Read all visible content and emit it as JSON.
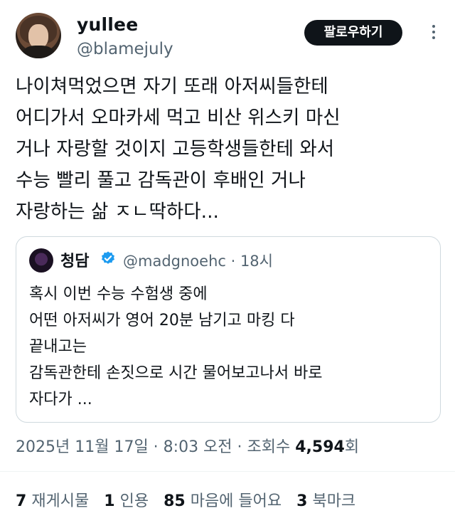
{
  "author": {
    "name": "yullee",
    "handle": "@blamejuly"
  },
  "follow_button": "팔로우하기",
  "tweet_text": "나이쳐먹었으면 자기 또래 아저씨들한테\n어디가서 오마카세 먹고 비산 위스키 마신\n거나 자랑할 것이지 고등학생들한테 와서\n수능 빨리 풀고 감독관이 후배인 거나\n자랑하는 삶 ㅈㄴ딱하다...",
  "quoted_tweet": {
    "name": "청담",
    "handle_time": "@madgnoehc · 18시",
    "text": "혹시 이번 수능 수험생 중에\n어떤 아저씨가 영어 20분 남기고 마킹 다\n끝내고는\n감독관한테 손짓으로 시간 물어보고나서 바로\n자다가 ..."
  },
  "timestamp": {
    "datetime": "2025년 11월 17일 · 8:03 오전 · 조회수 ",
    "views": "4,594",
    "views_suffix": "회"
  },
  "stats": {
    "retweets": "7",
    "retweets_label": "재게시물",
    "quotes": "1",
    "quotes_label": "인용",
    "likes": "85",
    "likes_label": "마음에 들어요",
    "bookmarks": "3",
    "bookmarks_label": "북마크"
  },
  "colors": {
    "text": "#0f1419",
    "secondary": "#536471",
    "verified": "#1d9bf0",
    "border": "#cfd9de"
  }
}
